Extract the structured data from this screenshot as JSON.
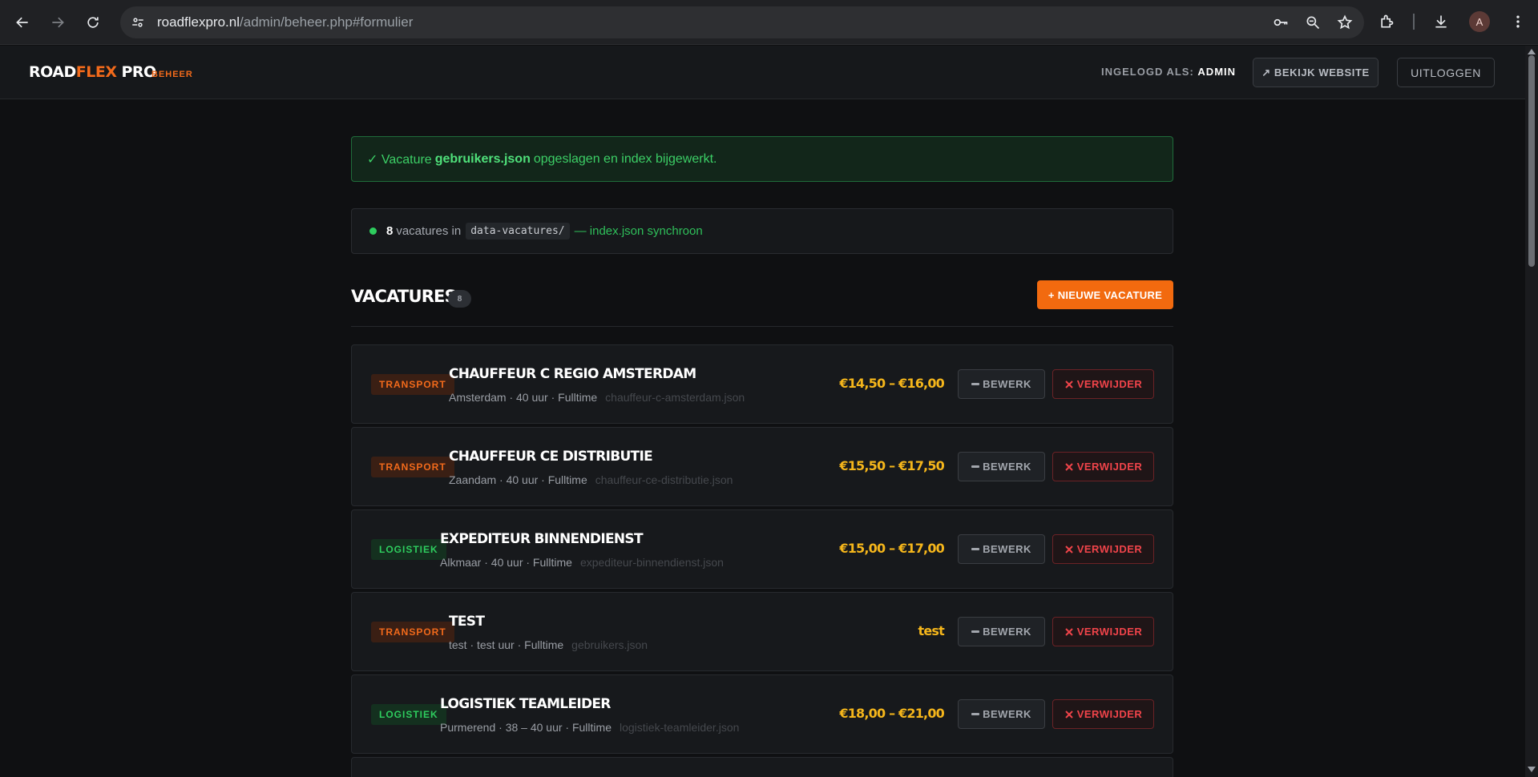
{
  "browser": {
    "url_host": "roadflexpro.nl",
    "url_path": "/admin/beheer.php#formulier",
    "profile_initial": "A"
  },
  "header": {
    "logo_road": "ROAD",
    "logo_flex": "FLEX",
    "logo_pro": "PRO",
    "section_tag": "BEHEER",
    "logged_in_label": "INGELOGD ALS:",
    "logged_in_user": "ADMIN",
    "view_site_label": "↗ BEKIJK WEBSITE",
    "logout_label": "UITLOGGEN"
  },
  "alert": {
    "prefix": "✓ Vacature",
    "file": "gebruikers.json",
    "suffix": "opgeslagen en index bijgewerkt."
  },
  "status": {
    "count": "8",
    "text": "vacatures in",
    "folder": "data-vacatures/",
    "sync": "— index.json synchroon"
  },
  "list": {
    "title": "VACATURES",
    "count": "8",
    "new_label": "+ NIEUWE VACATURE",
    "edit_label": "BEWERK",
    "delete_label": "VERWIJDER",
    "items": [
      {
        "category": "TRANSPORT",
        "title": "CHAUFFEUR C REGIO AMSTERDAM",
        "meta": "Amsterdam · 40 uur · Fulltime",
        "file": "chauffeur-c-amsterdam.json",
        "salary": "€14,50 – €16,00"
      },
      {
        "category": "TRANSPORT",
        "title": "CHAUFFEUR CE DISTRIBUTIE",
        "meta": "Zaandam · 40 uur · Fulltime",
        "file": "chauffeur-ce-distributie.json",
        "salary": "€15,50 – €17,50"
      },
      {
        "category": "LOGISTIEK",
        "title": "EXPEDITEUR BINNENDIENST",
        "meta": "Alkmaar · 40 uur · Fulltime",
        "file": "expediteur-binnendienst.json",
        "salary": "€15,00 – €17,00"
      },
      {
        "category": "TRANSPORT",
        "title": "TEST",
        "meta": "test · test uur · Fulltime",
        "file": "gebruikers.json",
        "salary": "test"
      },
      {
        "category": "LOGISTIEK",
        "title": "LOGISTIEK TEAMLEIDER",
        "meta": "Purmerend · 38 – 40 uur · Fulltime",
        "file": "logistiek-teamleider.json",
        "salary": "€18,00 – €21,00"
      }
    ]
  },
  "colors": {
    "accent": "#f26a1b",
    "success": "#2ecc5e",
    "salary": "#f5b61b",
    "danger": "#f0444a"
  }
}
